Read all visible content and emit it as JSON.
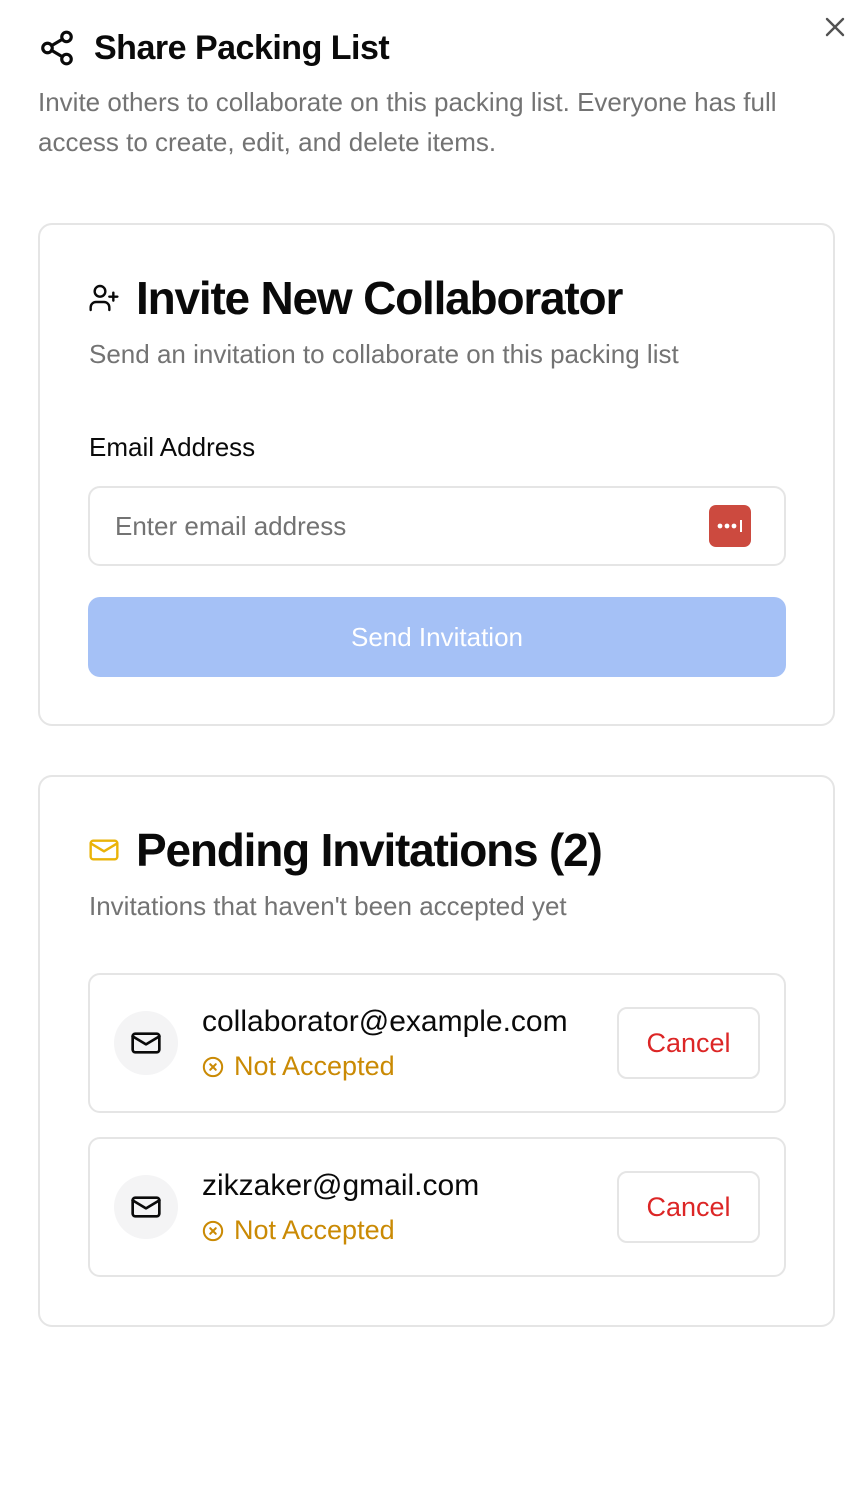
{
  "dialog": {
    "title": "Share Packing List",
    "description": "Invite others to collaborate on this packing list. Everyone has full access to create, edit, and delete items.",
    "close_icon": "close-icon",
    "title_icon": "share-icon"
  },
  "invite": {
    "title": "Invite New Collaborator",
    "title_icon": "user-plus-icon",
    "description": "Send an invitation to collaborate on this packing list",
    "email_label": "Email Address",
    "email_placeholder": "Enter email address",
    "email_value": "",
    "password_manager_icon": "password-manager-icon",
    "send_label": "Send Invitation",
    "send_disabled": true,
    "send_color": "#a5c1f6"
  },
  "pending": {
    "title": "Pending Invitations (2)",
    "title_icon": "mail-icon",
    "icon_color": "#eab308",
    "description": "Invitations that haven't been accepted yet",
    "items": [
      {
        "email": "collaborator@example.com",
        "status": "Not Accepted",
        "cancel_label": "Cancel"
      },
      {
        "email": "zikzaker@gmail.com",
        "status": "Not Accepted",
        "cancel_label": "Cancel"
      }
    ],
    "status_color": "#ca8a04",
    "cancel_color": "#dc2626"
  }
}
